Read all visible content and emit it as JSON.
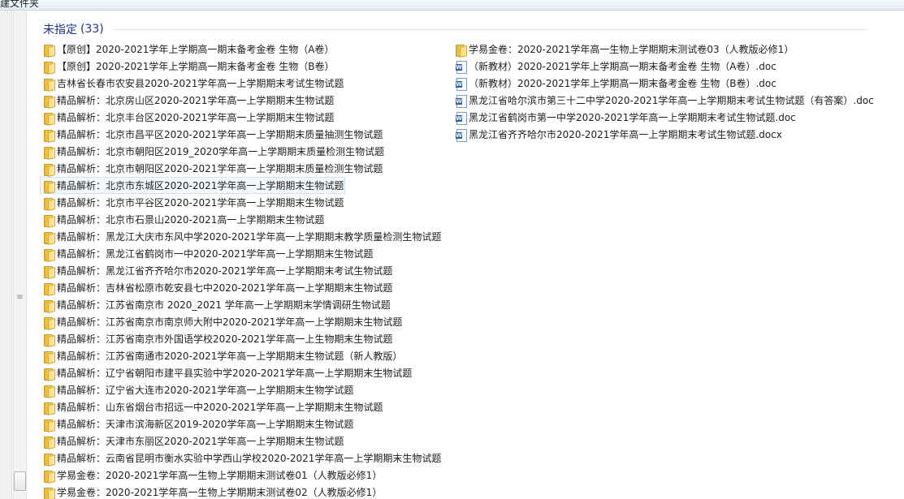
{
  "window": {
    "title": "建文件夹"
  },
  "group": {
    "title": "未指定",
    "count": "(33)"
  },
  "left_items": [
    {
      "label": "【原创】2020-2021学年上学期高一期末备考金卷 生物（A卷）",
      "icon": "folder-icon"
    },
    {
      "label": "【原创】2020-2021学年上学期高一期末备考金卷 生物（B卷）",
      "icon": "folder-icon"
    },
    {
      "label": "吉林省长春市农安县2020-2021学年高一上学期期末考试生物试题",
      "icon": "folder-icon"
    },
    {
      "label": "精品解析：北京房山区2020-2021学年高一上学期期末生物试题",
      "icon": "folder-icon"
    },
    {
      "label": "精品解析：北京丰台区2020-2021学年高一上学期期末生物试题",
      "icon": "folder-icon"
    },
    {
      "label": "精品解析：北京市昌平区2020-2021学年高一上学期期末质量抽测生物试题",
      "icon": "folder-icon"
    },
    {
      "label": "精品解析：北京市朝阳区2019_2020学年高一上学期期末质量检测生物试题",
      "icon": "folder-icon"
    },
    {
      "label": "精品解析：北京市朝阳区2020-2021学年高一上学期期末质量检测生物试题",
      "icon": "folder-icon"
    },
    {
      "label": "精品解析：北京市东城区2020-2021学年高一上学期期末生物试题",
      "icon": "folder-icon",
      "selected": true
    },
    {
      "label": "精品解析：北京市平谷区2020-2021学年高一上学期期末生物试题",
      "icon": "folder-icon"
    },
    {
      "label": "精品解析：北京市石景山2020-2021高一上学期期末生物试题",
      "icon": "folder-icon"
    },
    {
      "label": "精品解析：黑龙江大庆市东风中学2020-2021学年高一上学期期末教学质量检测生物试题",
      "icon": "folder-icon"
    },
    {
      "label": "精品解析：黑龙江省鹤岗市一中2020-2021学年高一上学期期末生物试题",
      "icon": "folder-icon"
    },
    {
      "label": "精品解析：黑龙江省齐齐哈尔市2020-2021学年高一上学期期末考试生物试题",
      "icon": "folder-icon"
    },
    {
      "label": "精品解析：吉林省松原市乾安县七中2020-2021学年高一上学期期末生物试题",
      "icon": "folder-icon"
    },
    {
      "label": "精品解析：江苏省南京市 2020_2021 学年高一上学期期末学情调研生物试题",
      "icon": "folder-icon"
    },
    {
      "label": "精品解析：江苏省南京市南京师大附中2020-2021学年高一上学期期末生物试题",
      "icon": "folder-icon"
    },
    {
      "label": "精品解析：江苏省南京市外国语学校2020-2021学年高一上生物期末生物试题",
      "icon": "folder-icon"
    },
    {
      "label": "精品解析：江苏省南通市2020-2021学年高一上学期期末生物试题（新人教版）",
      "icon": "folder-icon"
    },
    {
      "label": "精品解析：辽宁省朝阳市建平县实验中学2020-2021学年高一上学期期末生物试题",
      "icon": "folder-icon"
    },
    {
      "label": "精品解析：辽宁省大连市2020-2021学年高一上学期期末生物学试题",
      "icon": "folder-icon"
    },
    {
      "label": "精品解析：山东省烟台市招远一中2020-2021学年高一上学期期末生物试题",
      "icon": "folder-icon"
    },
    {
      "label": "精品解析：天津市滨海新区2019-2020学年高一上学期期末生物试题",
      "icon": "folder-icon"
    },
    {
      "label": "精品解析：天津市东丽区2020-2021学年高一上学期期末生物试题",
      "icon": "folder-icon"
    },
    {
      "label": "精品解析：云南省昆明市衡水实验中学西山学校2020-2021学年高一上学期期末生物试题",
      "icon": "folder-icon"
    },
    {
      "label": "学易金卷：2020-2021学年高一生物上学期期末测试卷01（人教版必修1）",
      "icon": "folder-icon"
    },
    {
      "label": "学易金卷：2020-2021学年高一生物上学期期末测试卷02（人教版必修1）",
      "icon": "folder-icon"
    }
  ],
  "right_items": [
    {
      "label": "学易金卷：2020-2021学年高一生物上学期期末测试卷03（人教版必修1）",
      "icon": "folder-icon"
    },
    {
      "label": "（新教材）2020-2021学年上学期高一期末备考金卷 生物（A卷）.doc",
      "icon": "doc-icon"
    },
    {
      "label": "（新教材）2020-2021学年上学期高一期末备考金卷 生物（B卷）.doc",
      "icon": "doc-icon"
    },
    {
      "label": "黑龙江省哈尔滨市第三十二中学2020-2021学年高一上学期期末考试生物试题（有答案）.doc",
      "icon": "doc-icon"
    },
    {
      "label": "黑龙江省鹤岗市第一中学2020-2021学年高一上学期期末考试生物试题.doc",
      "icon": "doc-icon"
    },
    {
      "label": "黑龙江省齐齐哈尔市2020-2021学年高一上学期期末考试生物试题.docx",
      "icon": "doc-icon"
    }
  ]
}
